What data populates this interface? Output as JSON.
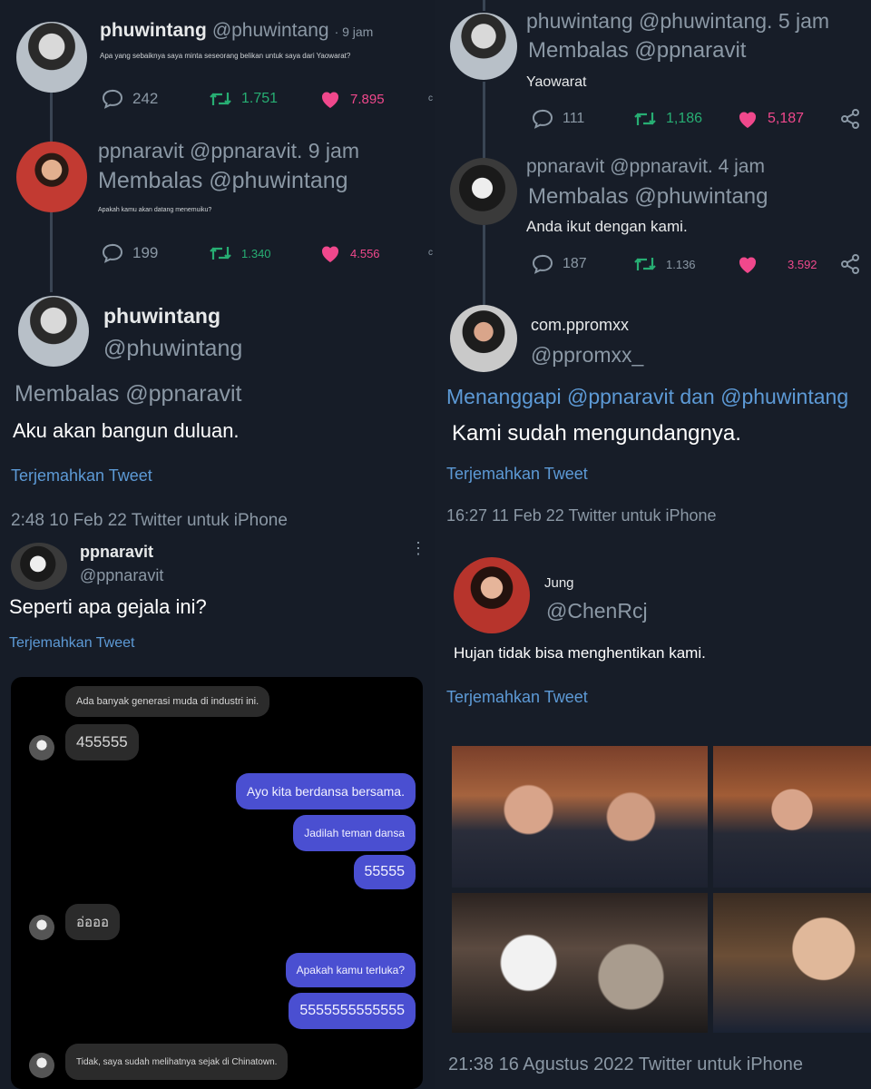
{
  "colors": {
    "background": "#151b26",
    "like": "#f0488c",
    "retweet": "#27ae73",
    "link": "#5d9ad6",
    "bubble_sent": "#4a4fd1",
    "bubble_received": "#2b2b2b"
  },
  "left": {
    "tweet1": {
      "name": "phuwintang",
      "handle": "@phuwintang",
      "time": "· 9 jam",
      "text": "Apa yang sebaiknya saya minta seseorang belikan untuk saya dari Yaowarat?",
      "replies": "242",
      "retweets": "1.751",
      "likes": "7.895",
      "extra": "c"
    },
    "tweet2": {
      "header": "ppnaravit @ppnaravit. 9 jam",
      "reply_to": "Membalas @phuwintang",
      "text": "Apakah kamu akan datang menemuiku?",
      "replies": "199",
      "retweets": "1.340",
      "likes": "4.556",
      "extra": "c"
    },
    "tweet3": {
      "name": "phuwintang",
      "handle": "@phuwintang",
      "reply_to": "Membalas @ppnaravit",
      "text": "Aku akan bangun duluan.",
      "translate": "Terjemahkan Tweet",
      "timestamp": "2:48 10 Feb 22 Twitter untuk iPhone"
    },
    "tweet4": {
      "name": "ppnaravit",
      "handle": "@ppnaravit",
      "text": "Seperti apa gejala ini?",
      "translate": "Terjemahkan Tweet"
    },
    "chat": {
      "messages": [
        "Ada banyak generasi muda di industri ini.",
        "455555",
        "Ayo kita berdansa bersama.",
        "Jadilah teman dansa",
        "55555",
        "อ่อออ",
        "Apakah kamu terluka?",
        "5555555555555",
        "Tidak, saya sudah melihatnya sejak di Chinatown."
      ]
    }
  },
  "right": {
    "tweet1": {
      "header": "phuwintang @phuwintang. 5 jam",
      "reply_to": "Membalas @ppnaravit",
      "text": "Yaowarat",
      "replies": "111",
      "retweets": "1,186",
      "likes": "5,187"
    },
    "tweet2": {
      "header": "ppnaravit @ppnaravit. 4 jam",
      "reply_to": "Membalas @phuwintang",
      "text": "Anda ikut dengan kami.",
      "replies": "187",
      "retweets": "1.136",
      "likes": "3.592"
    },
    "tweet3": {
      "name": "com.ppromxx",
      "handle": "@ppromxx_",
      "reply_to": "Menanggapi @ppnaravit dan @phuwintang",
      "text": "Kami sudah mengundangnya.",
      "translate": "Terjemahkan Tweet",
      "timestamp": "16:27 11 Feb 22 Twitter untuk iPhone"
    },
    "tweet4": {
      "name": "Jung",
      "handle": "@ChenRcj",
      "text": "Hujan tidak bisa menghentikan kami.",
      "translate": "Terjemahkan Tweet",
      "timestamp": "21:38 16 Agustus 2022 Twitter untuk iPhone"
    }
  }
}
